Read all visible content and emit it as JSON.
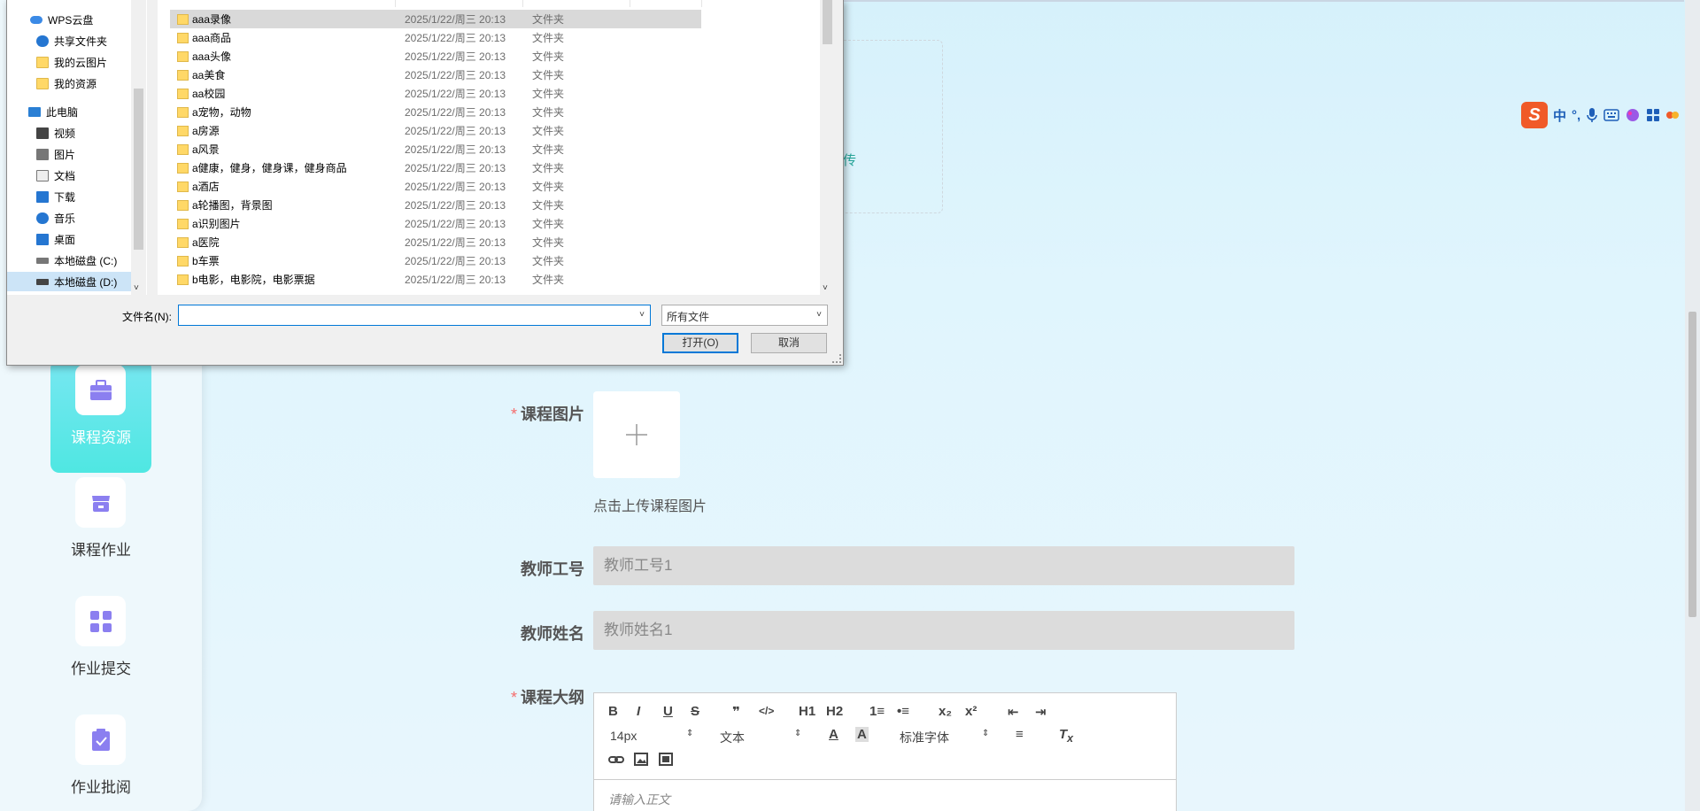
{
  "sidebar": {
    "items": [
      {
        "label": "课程资源",
        "active": true
      },
      {
        "label": "课程作业",
        "active": false
      },
      {
        "label": "作业提交",
        "active": false
      },
      {
        "label": "作业批阅",
        "active": false
      }
    ]
  },
  "form": {
    "course_image": {
      "label": "课程图片",
      "hint": "点击上传课程图片"
    },
    "teacher_id": {
      "label": "教师工号",
      "value": "教师工号1"
    },
    "teacher_name": {
      "label": "教师姓名",
      "value": "教师姓名1"
    },
    "syllabus": {
      "label": "课程大纲",
      "placeholder": "请输入正文"
    },
    "upload_partial_text": "传"
  },
  "editor": {
    "font_size": "14px",
    "paragraph": "文本",
    "font_family": "标准字体",
    "buttons": [
      "B",
      "I",
      "U",
      "S",
      "❞",
      "</>",
      "H1",
      "H2",
      "1≡",
      "•≡",
      "x₂",
      "x²",
      "⇤",
      "⇥"
    ]
  },
  "ime": {
    "lang": "中",
    "punct": "°,"
  },
  "dialog": {
    "nav": [
      {
        "label": "WPS云盘",
        "icon": "cloud-icon"
      },
      {
        "label": "共享文件夹",
        "icon": "share-folder-icon"
      },
      {
        "label": "我的云图片",
        "icon": "folder-icon"
      },
      {
        "label": "我的资源",
        "icon": "folder-icon"
      },
      {
        "label": "此电脑",
        "icon": "pc-icon"
      },
      {
        "label": "视频",
        "icon": "video-icon"
      },
      {
        "label": "图片",
        "icon": "picture-icon"
      },
      {
        "label": "文档",
        "icon": "document-icon"
      },
      {
        "label": "下载",
        "icon": "download-icon"
      },
      {
        "label": "音乐",
        "icon": "music-icon"
      },
      {
        "label": "桌面",
        "icon": "desktop-icon"
      },
      {
        "label": "本地磁盘 (C:)",
        "icon": "disk-icon"
      },
      {
        "label": "本地磁盘 (D:)",
        "icon": "disk-icon",
        "selected": true
      }
    ],
    "files": [
      {
        "name": "aaa录像",
        "date": "2025/1/22/周三 20:13",
        "type": "文件夹",
        "selected": true
      },
      {
        "name": "aaa商品",
        "date": "2025/1/22/周三 20:13",
        "type": "文件夹"
      },
      {
        "name": "aaa头像",
        "date": "2025/1/22/周三 20:13",
        "type": "文件夹"
      },
      {
        "name": "aa美食",
        "date": "2025/1/22/周三 20:13",
        "type": "文件夹"
      },
      {
        "name": "aa校园",
        "date": "2025/1/22/周三 20:13",
        "type": "文件夹"
      },
      {
        "name": "a宠物，动物",
        "date": "2025/1/22/周三 20:13",
        "type": "文件夹"
      },
      {
        "name": "a房源",
        "date": "2025/1/22/周三 20:13",
        "type": "文件夹"
      },
      {
        "name": "a风景",
        "date": "2025/1/22/周三 20:13",
        "type": "文件夹"
      },
      {
        "name": "a健康，健身，健身课，健身商品",
        "date": "2025/1/22/周三 20:13",
        "type": "文件夹"
      },
      {
        "name": "a酒店",
        "date": "2025/1/22/周三 20:13",
        "type": "文件夹"
      },
      {
        "name": "a轮播图，背景图",
        "date": "2025/1/22/周三 20:13",
        "type": "文件夹"
      },
      {
        "name": "a识别图片",
        "date": "2025/1/22/周三 20:13",
        "type": "文件夹"
      },
      {
        "name": "a医院",
        "date": "2025/1/22/周三 20:13",
        "type": "文件夹"
      },
      {
        "name": "b车票",
        "date": "2025/1/22/周三 20:13",
        "type": "文件夹"
      },
      {
        "name": "b电影，电影院，电影票据",
        "date": "2025/1/22/周三 20:13",
        "type": "文件夹"
      }
    ],
    "filename_label": "文件名(N):",
    "filename_value": "",
    "filter_value": "所有文件",
    "open_label": "打开(O)",
    "cancel_label": "取消"
  }
}
